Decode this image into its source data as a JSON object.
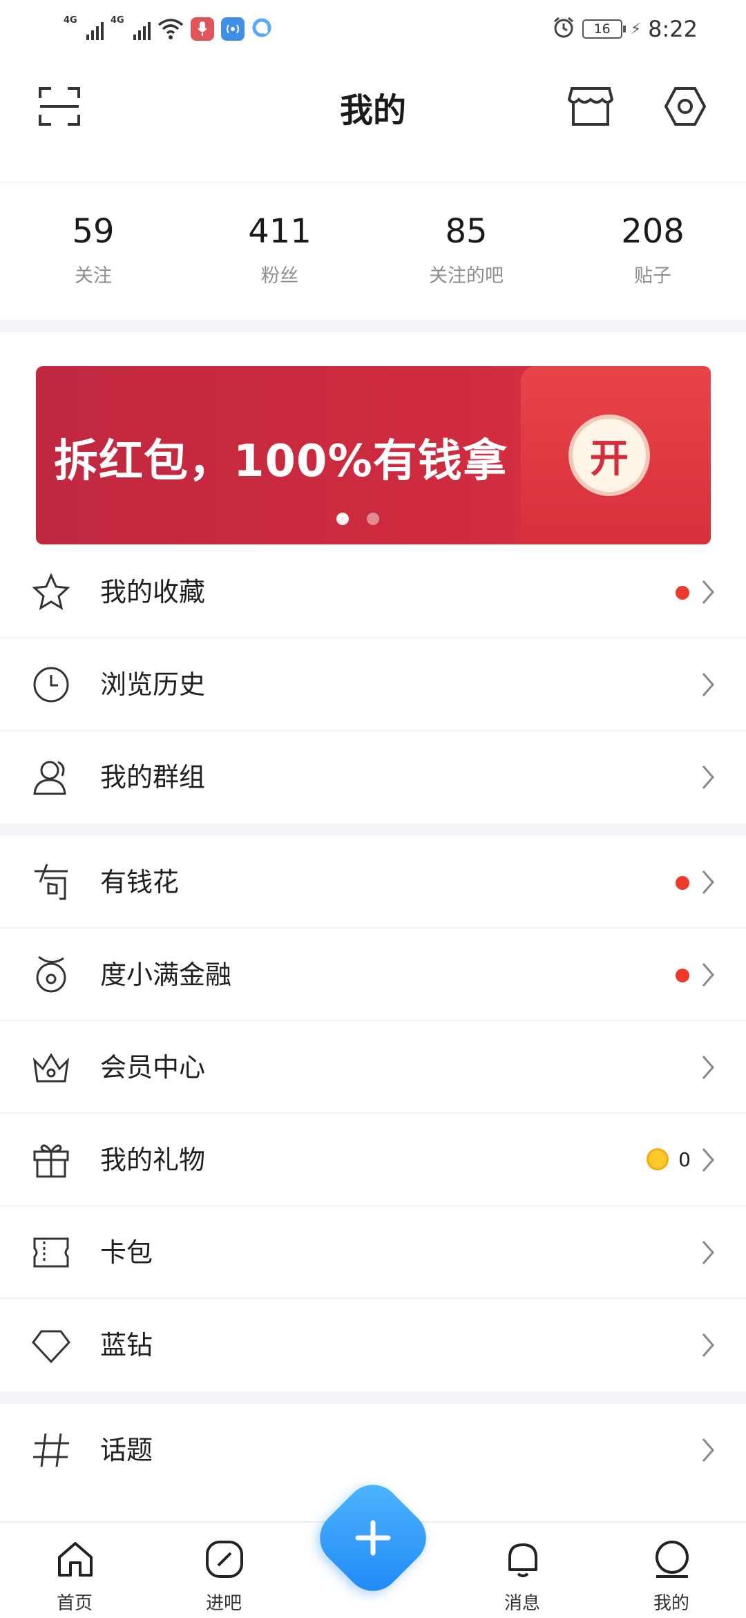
{
  "status_bar": {
    "network_1": "4G",
    "network_2": "4G",
    "battery": "16",
    "time": "8:22"
  },
  "header": {
    "title": "我的",
    "left_icon": "scan-icon",
    "right_icons": [
      "shop-icon",
      "settings-icon"
    ]
  },
  "stats": [
    {
      "value": "59",
      "label": "关注"
    },
    {
      "value": "411",
      "label": "粉丝"
    },
    {
      "value": "85",
      "label": "关注的吧"
    },
    {
      "value": "208",
      "label": "贴子"
    }
  ],
  "banner": {
    "text": "拆红包，100%有钱拿",
    "button": "开",
    "page_count": 2,
    "active_index": 0
  },
  "menu_group_1": [
    {
      "label": "我的收藏",
      "icon": "star-icon",
      "red_dot": true
    },
    {
      "label": "浏览历史",
      "icon": "clock-icon",
      "red_dot": false
    },
    {
      "label": "我的群组",
      "icon": "group-icon",
      "red_dot": false
    }
  ],
  "menu_group_2": [
    {
      "label": "有钱花",
      "icon": "money-flower-icon",
      "red_dot": true
    },
    {
      "label": "度小满金融",
      "icon": "finance-icon",
      "red_dot": true
    },
    {
      "label": "会员中心",
      "icon": "crown-icon",
      "red_dot": false
    },
    {
      "label": "我的礼物",
      "icon": "gift-icon",
      "red_dot": false,
      "coin_count": "0"
    },
    {
      "label": "卡包",
      "icon": "card-wallet-icon",
      "red_dot": false
    },
    {
      "label": "蓝钻",
      "icon": "diamond-icon",
      "red_dot": false
    }
  ],
  "menu_group_3": [
    {
      "label": "话题",
      "icon": "hashtag-icon",
      "red_dot": false
    }
  ],
  "bottom_nav": [
    {
      "label": "首页",
      "icon": "home-icon"
    },
    {
      "label": "进吧",
      "icon": "compass-icon"
    },
    {
      "label": "消息",
      "icon": "bell-icon"
    },
    {
      "label": "我的",
      "icon": "profile-icon"
    }
  ],
  "colors": {
    "accent": "#2b8ff7",
    "red_dot": "#ee3a2a",
    "banner_red": "#c8293e",
    "section_gap": "#f5f4f8"
  }
}
